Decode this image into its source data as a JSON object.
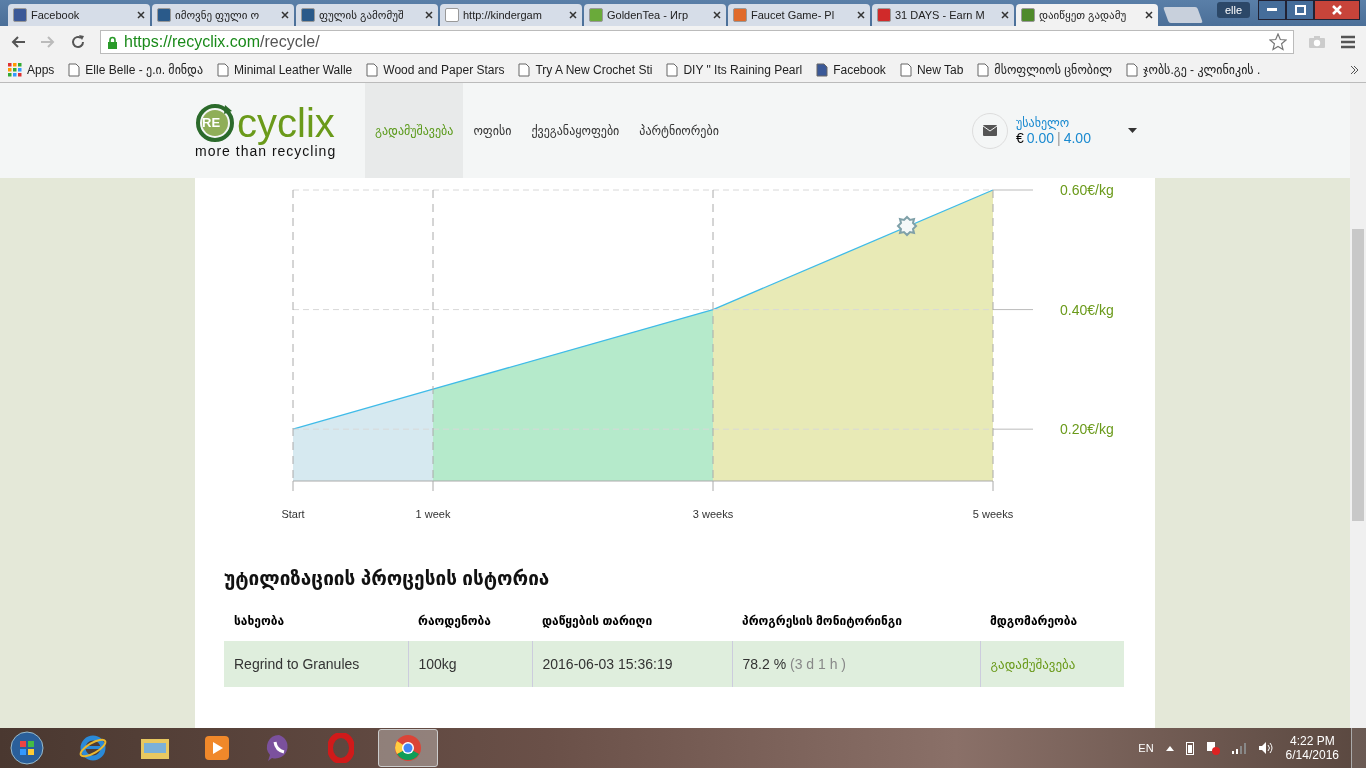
{
  "browser": {
    "tabs": [
      {
        "title": "Facebook",
        "selected": false
      },
      {
        "title": "იმოვნე ფული ო",
        "selected": false
      },
      {
        "title": "ფულის გამომუშ",
        "selected": false
      },
      {
        "title": "http://kindergam",
        "selected": false
      },
      {
        "title": "GoldenTea - Игр",
        "selected": false
      },
      {
        "title": "Faucet Game- Pl",
        "selected": false
      },
      {
        "title": "31 DAYS - Earn M",
        "selected": false
      },
      {
        "title": "დაიწყეთ გადამუ",
        "selected": true
      }
    ],
    "profile": "elle",
    "url_host": "https://recyclix.com",
    "url_path": "/recycle/",
    "bookmarks": [
      "Apps",
      "Elle Belle - ე.ი. მინდა",
      "Minimal Leather Walle",
      "Wood and Paper Stars",
      "Try A New Crochet Sti",
      "DIY \" Its Raining Pearl",
      "Facebook",
      "New Tab",
      "მსოფლიოს ცნობილ",
      "ჯობს.გე - კლინიკის ."
    ]
  },
  "site": {
    "logo_mark": "RE",
    "logo_name": "cyclix",
    "tagline": "more than recycling",
    "nav": [
      {
        "label": "გადამუშავება",
        "selected": true
      },
      {
        "label": "ოფისი",
        "selected": false
      },
      {
        "label": "ქვეგანაყოფები",
        "selected": false
      },
      {
        "label": "პარტნიორები",
        "selected": false
      }
    ],
    "account": {
      "name": "უსახელო",
      "currency": "€",
      "balance": "0.00",
      "separator": "|",
      "bonus": "4.00"
    }
  },
  "chart_data": {
    "type": "area",
    "grid": true,
    "x": [
      0,
      1,
      3,
      5
    ],
    "xlim": [
      0,
      5
    ],
    "ylim": [
      0.1133,
      0.6
    ],
    "xticks": [
      {
        "value": 0,
        "label": "Start"
      },
      {
        "value": 1,
        "label": "1 week"
      },
      {
        "value": 3,
        "label": "3 weeks"
      },
      {
        "value": 5,
        "label": "5 weeks"
      }
    ],
    "yticks": [
      {
        "value": 0.2,
        "label": "0.20€/kg"
      },
      {
        "value": 0.4,
        "label": "0.40€/kg"
      },
      {
        "value": 0.6,
        "label": "0.60€/kg"
      }
    ],
    "series": [
      {
        "color": "#d6e9f0",
        "values": [
          0.2,
          0.267,
          null,
          null
        ]
      },
      {
        "color": "#b5eacb",
        "values": [
          null,
          0.267,
          0.4,
          null
        ]
      },
      {
        "color": "#e8eab6",
        "values": [
          null,
          null,
          0.4,
          0.6
        ]
      }
    ]
  },
  "history": {
    "title": "უტილიზაციის პროცესის ისტორია",
    "columns": [
      "სახეობა",
      "რაოდენობა",
      "დაწყების თარიღი",
      "პროგრესის მონიტორინგი",
      "მდგომარეობა"
    ],
    "rows": [
      {
        "type": "Regrind to Granules",
        "amount": "100kg",
        "started": "2016-06-03 15:36:19",
        "progress": "78.2 %",
        "remaining": "(3 d 1 h )",
        "status": "გადამუშავება"
      }
    ]
  },
  "taskbar": {
    "language": "EN",
    "time": "4:22 PM",
    "date": "6/14/2016"
  }
}
